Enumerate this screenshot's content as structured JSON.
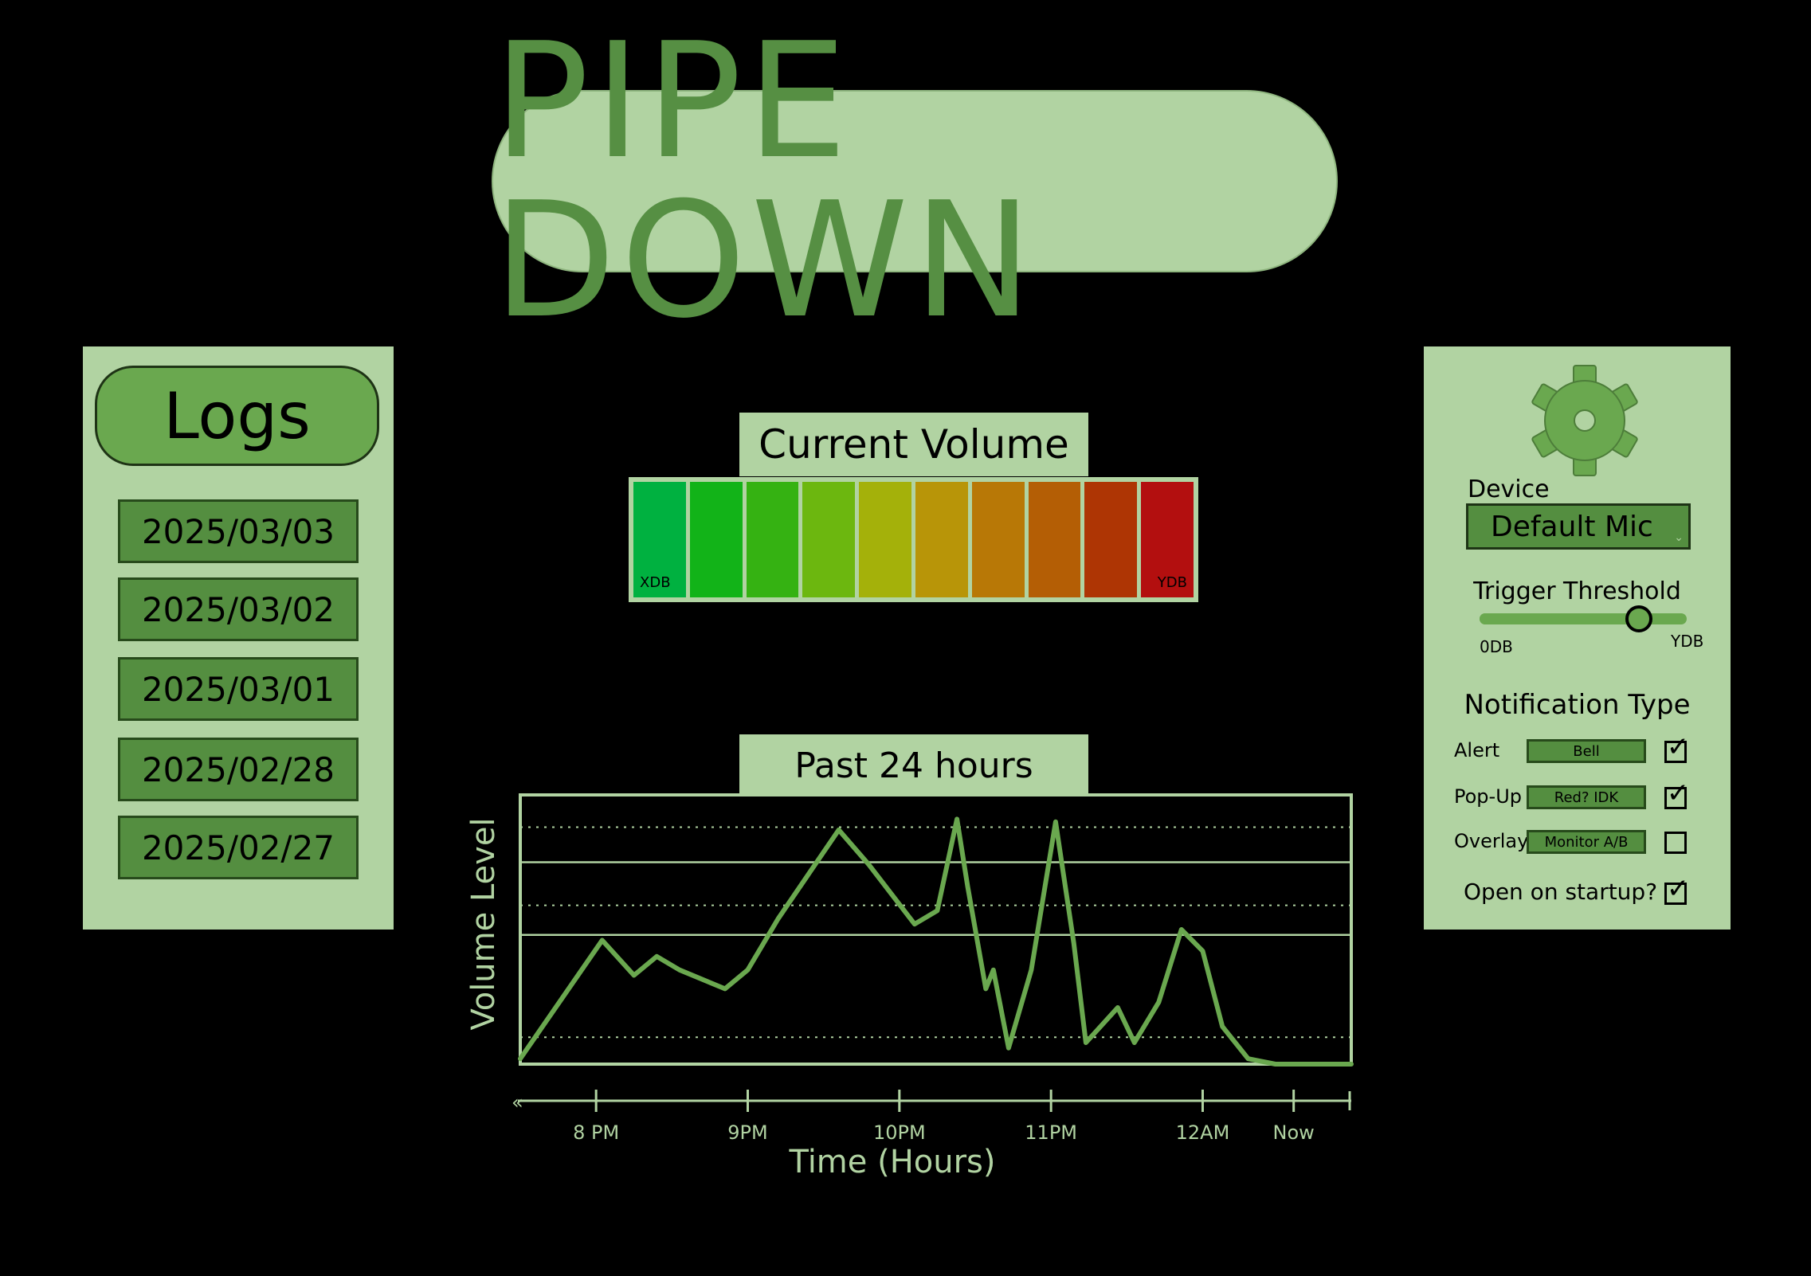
{
  "app_title": "PIPE DOWN",
  "colors": {
    "background": "#000000",
    "panel": "#b1d3a2",
    "accent": "#6aa84f",
    "accent_dark": "#548e40",
    "title_text": "#568f43"
  },
  "logs": {
    "title": "Logs",
    "entries": [
      "2025/03/03",
      "2025/03/02",
      "2025/03/01",
      "2025/02/28",
      "2025/02/27"
    ]
  },
  "current_volume": {
    "title": "Current Volume",
    "min_label": "XDB",
    "max_label": "YDB",
    "segment_colors": [
      "#00b140",
      "#12b318",
      "#35b212",
      "#6cb70f",
      "#a4b10a",
      "#b89508",
      "#b87806",
      "#b45e05",
      "#ae3504",
      "#b30f0f"
    ]
  },
  "chart_data": {
    "type": "line",
    "title": "Past 24 hours",
    "xlabel": "Time (Hours)",
    "ylabel": "Volume Level",
    "x_ticks": [
      "8 PM",
      "9PM",
      "10PM",
      "11PM",
      "12AM",
      "Now"
    ],
    "x_tick_positions": [
      0,
      1,
      2,
      3,
      4,
      4.6
    ],
    "xlim": [
      -0.5,
      4.98
    ],
    "ylim": [
      0,
      100
    ],
    "grid": true,
    "series": [
      {
        "x": [
          -0.5,
          0.04,
          0.25,
          0.4,
          0.55,
          0.85,
          1.0,
          1.2,
          1.6,
          1.8,
          2.1,
          2.25,
          2.38,
          2.45,
          2.57,
          2.62,
          2.72,
          2.87,
          3.03,
          3.15,
          3.23,
          3.44,
          3.55,
          3.71,
          3.86,
          4.0,
          4.13,
          4.3,
          4.48,
          4.64,
          4.85,
          4.98
        ],
        "y": [
          2,
          46,
          33,
          40,
          35,
          28,
          35,
          54,
          87,
          74,
          52,
          57,
          91,
          66,
          28,
          35,
          6,
          35,
          90,
          45,
          8,
          21,
          8,
          23,
          50,
          42,
          14,
          2,
          0,
          0,
          0,
          0
        ]
      }
    ]
  },
  "settings": {
    "gear_icon": "gear-icon",
    "device_label": "Device",
    "device_value": "Default Mic",
    "threshold_label": "Trigger Threshold",
    "threshold_min": "0DB",
    "threshold_max": "YDB",
    "threshold_value": 0.77,
    "notification_title": "Notification Type",
    "notifications": [
      {
        "label": "Alert",
        "value": "Bell",
        "checked": true
      },
      {
        "label": "Pop-Up",
        "value": "Red? IDK",
        "checked": true
      },
      {
        "label": "Overlay",
        "value": "Monitor A/B",
        "checked": false
      }
    ],
    "startup_label": "Open on startup?",
    "startup_checked": true
  }
}
